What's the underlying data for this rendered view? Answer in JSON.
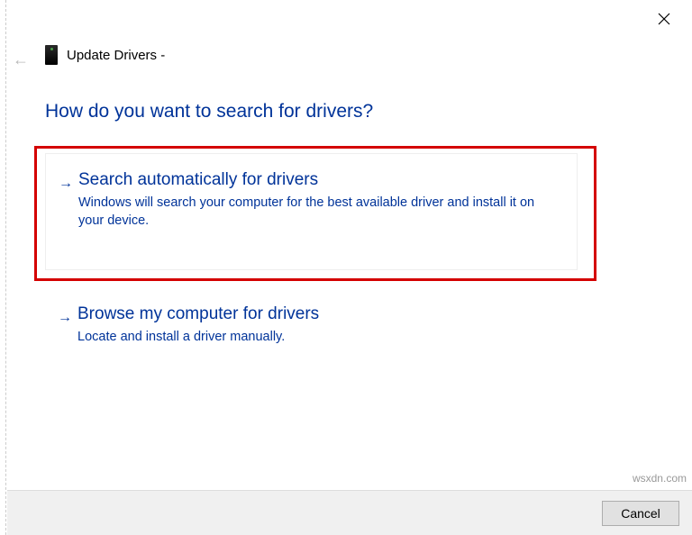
{
  "header": {
    "title": "Update Drivers -"
  },
  "heading": "How do you want to search for drivers?",
  "options": [
    {
      "title": "Search automatically for drivers",
      "desc": "Windows will search your computer for the best available driver and install it on your device."
    },
    {
      "title": "Browse my computer for drivers",
      "desc": "Locate and install a driver manually."
    }
  ],
  "footer": {
    "cancel": "Cancel"
  },
  "watermark": "wsxdn.com"
}
